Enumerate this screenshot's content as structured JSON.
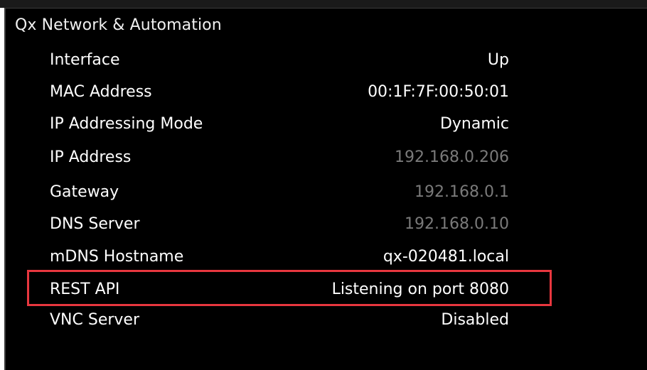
{
  "panel": {
    "title": "Qx Network & Automation"
  },
  "settings": [
    {
      "label": "Interface",
      "value": "Up",
      "dim": false
    },
    {
      "label": "MAC Address",
      "value": "00:1F:7F:00:50:01",
      "dim": false
    },
    {
      "label": "IP Addressing Mode",
      "value": "Dynamic",
      "dim": false
    },
    {
      "label": "IP Address",
      "value": "192.168.0.206",
      "dim": true
    },
    {
      "label": "Gateway",
      "value": "192.168.0.1",
      "dim": true
    },
    {
      "label": "DNS Server",
      "value": "192.168.0.10",
      "dim": true
    },
    {
      "label": "mDNS Hostname",
      "value": "qx-020481.local",
      "dim": false
    },
    {
      "label": "REST API",
      "value": "Listening on port 8080",
      "dim": false
    },
    {
      "label": "VNC Server",
      "value": "Disabled",
      "dim": false
    }
  ],
  "highlight": {
    "target": "REST API",
    "color": "#e8373f"
  },
  "colors": {
    "background": "#000000",
    "text": "#ffffff",
    "dim_text": "#7a7a7a"
  }
}
